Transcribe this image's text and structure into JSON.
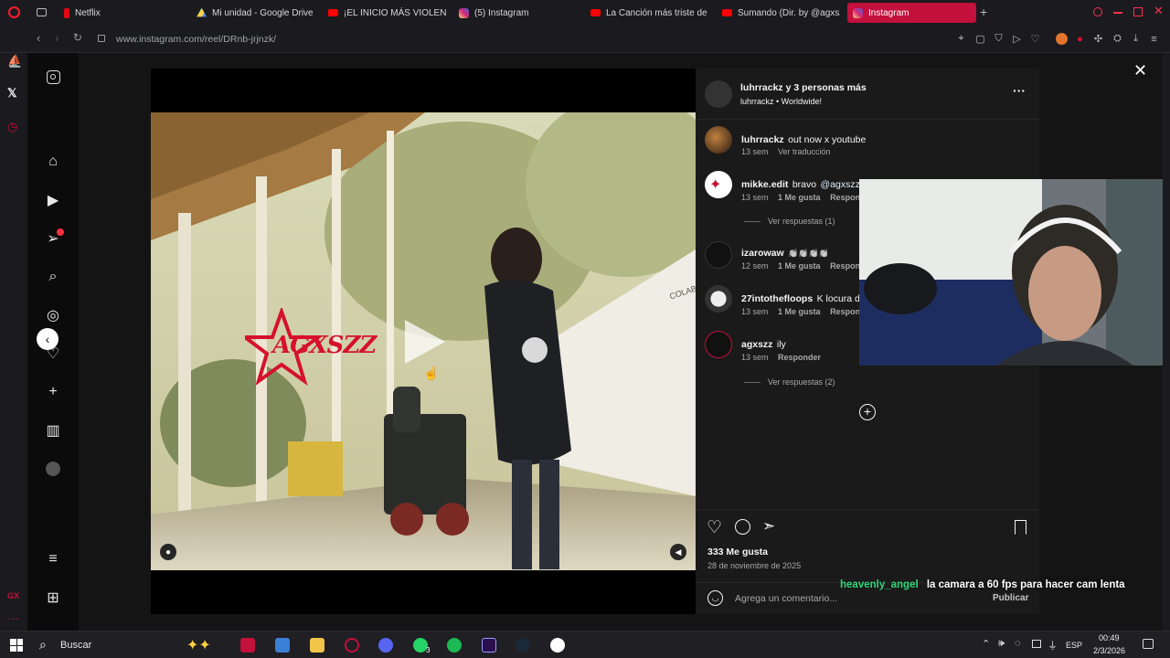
{
  "browser": {
    "tabs": [
      {
        "label": "Netflix",
        "color": "#e50914"
      },
      {
        "label": "Mi unidad - Google Drive",
        "color": "#1fa463"
      },
      {
        "label": "¡EL INICIO MÁS VIOLENTO",
        "color": "#ff0000"
      },
      {
        "label": "(5) Instagram",
        "color": "#d62976"
      },
      {
        "label": "La Canción más triste de l",
        "color": "#ff0000"
      },
      {
        "label": "Sumando (Dir. by @agxsz",
        "color": "#ff0000"
      },
      {
        "label": "Instagram",
        "color": "#d62976"
      }
    ],
    "url": "www.instagram.com/reel/DRnb-jrjnzk/"
  },
  "video": {
    "logo_text": "AGXSZZ",
    "sign_text": "COLAB"
  },
  "post": {
    "header_user": "luhrrackz y 3 personas más",
    "header_sub": "luhrrackz • Worldwide!",
    "comments": [
      {
        "user": "luhrrackz",
        "text": "out now x youtube",
        "time": "13 sem",
        "likes": "",
        "action": "Ver traducción"
      },
      {
        "user": "mikke.edit",
        "text": "bravo",
        "mention": "@agxszz",
        "time": "13 sem",
        "likes": "1 Me gusta",
        "action": "Responder",
        "replies": "Ver respuestas (1)"
      },
      {
        "user": "izarowaw",
        "text": "👏👏👏👏",
        "time": "12 sem",
        "likes": "1 Me gusta",
        "action": "Responder"
      },
      {
        "user": "27intothefloops",
        "text": "K locura d",
        "time": "13 sem",
        "likes": "1 Me gusta",
        "action": "Responder"
      },
      {
        "user": "agxszz",
        "text": "ily",
        "time": "13 sem",
        "likes": "",
        "action": "Responder",
        "replies": "Ver respuestas (2)"
      }
    ],
    "likes_count": "333 Me gusta",
    "date": "28 de noviembre de 2025",
    "comment_placeholder": "Agrega un comentario...",
    "publish_label": "Publicar"
  },
  "chat_overlay": {
    "user": "heavenly_angel",
    "message": "la camara a 60 fps para hacer cam lenta"
  },
  "taskbar": {
    "search_placeholder": "Buscar",
    "whatsapp_badge": "3",
    "lang": "ESP",
    "time": "00:49",
    "date": "2/3/2026"
  }
}
